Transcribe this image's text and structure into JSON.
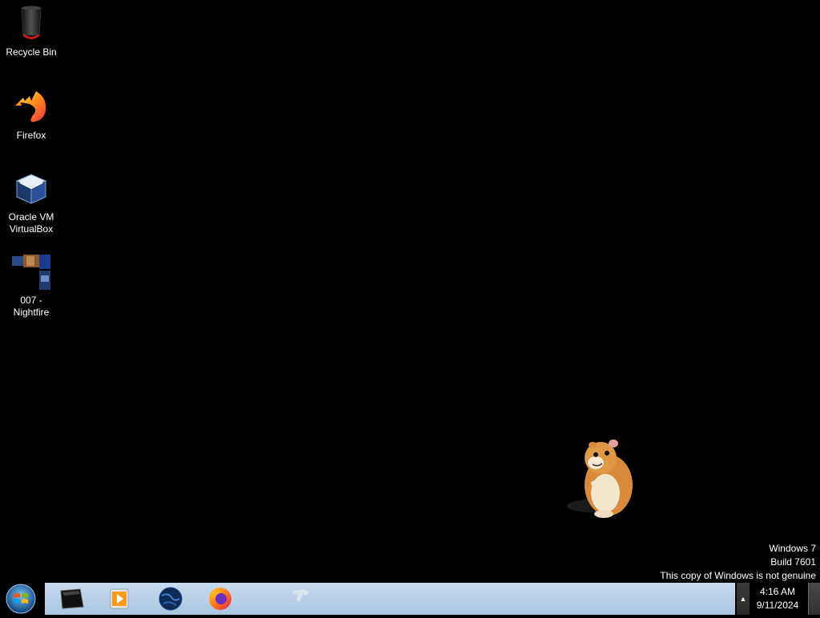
{
  "desktop": {
    "icons": [
      {
        "name": "recycle-bin",
        "label": "Recycle Bin",
        "icon": "recycle-bin-icon"
      },
      {
        "name": "firefox",
        "label": "Firefox",
        "icon": "firefox-icon"
      },
      {
        "name": "virtualbox",
        "label": "Oracle VM VirtualBox",
        "icon": "virtualbox-icon"
      },
      {
        "name": "nightfire",
        "label": "007 - Nightfire",
        "icon": "nightfire-game-icon"
      }
    ],
    "watermark": {
      "line1": "Windows 7",
      "line2": "Build 7601",
      "line3": "This copy of Windows is not genuine"
    }
  },
  "taskbar": {
    "start_icon": "windows-logo-icon",
    "pinned": [
      {
        "name": "command-prompt",
        "icon": "terminal-icon"
      },
      {
        "name": "media-player",
        "icon": "media-player-icon"
      },
      {
        "name": "globe-app",
        "icon": "globe-icon"
      },
      {
        "name": "firefox",
        "icon": "firefox-icon"
      },
      {
        "name": "unknown-app",
        "icon": "app-icon"
      }
    ],
    "tray": {
      "time": "4:16 AM",
      "date": "9/11/2024",
      "show_hidden_icons": "▲"
    }
  },
  "colors": {
    "desktop_bg": "#000000",
    "taskbar_band": "#b8d0ea",
    "text": "#ffffff"
  }
}
